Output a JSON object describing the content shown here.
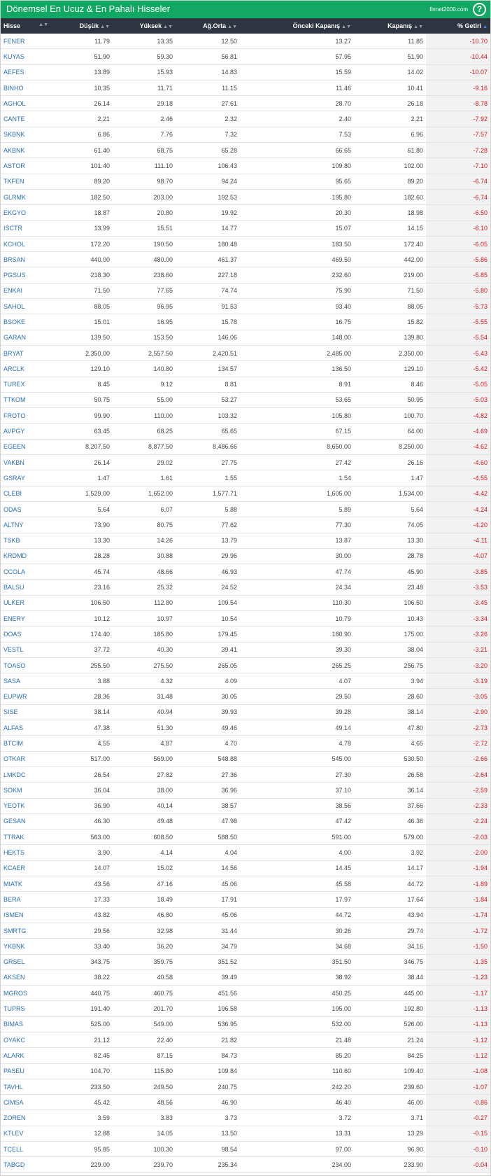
{
  "header": {
    "title": "Dönemsel En Ucuz & En Pahalı Hisseler",
    "brand": "finnet2000.com",
    "help": "?"
  },
  "columns": {
    "hisse": "Hisse",
    "dusuk": "Düşük",
    "yuksek": "Yüksek",
    "agorta": "Ağ.Orta",
    "onceki": "Önceki Kapanış",
    "kapanis": "Kapanış",
    "getiri": "% Getiri"
  },
  "icons": {
    "sort": "sort-arrows-icon",
    "sort_active": "sort-up-icon",
    "help": "help-circle-icon"
  },
  "colors": {
    "header_bg": "#10a862",
    "table_head_bg": "#2f3540",
    "symbol": "#2a6db5",
    "negative": "#d4141c"
  },
  "rows": [
    [
      "FENER",
      "11.79",
      "13.35",
      "12.50",
      "13.27",
      "11.85",
      "-10.70"
    ],
    [
      "KUYAS",
      "51.90",
      "59.30",
      "56.81",
      "57.95",
      "51.90",
      "-10.44"
    ],
    [
      "AEFES",
      "13.89",
      "15.93",
      "14.83",
      "15.59",
      "14.02",
      "-10.07"
    ],
    [
      "BINHO",
      "10.35",
      "11.71",
      "11.15",
      "11.46",
      "10.41",
      "-9.16"
    ],
    [
      "AGHOL",
      "26.14",
      "29.18",
      "27.61",
      "28.70",
      "26.18",
      "-8.78"
    ],
    [
      "CANTE",
      "2.21",
      "2.46",
      "2.32",
      "2.40",
      "2.21",
      "-7.92"
    ],
    [
      "SKBNK",
      "6.86",
      "7.76",
      "7.32",
      "7.53",
      "6.96",
      "-7.57"
    ],
    [
      "AKBNK",
      "61.40",
      "68.75",
      "65.28",
      "66.65",
      "61.80",
      "-7.28"
    ],
    [
      "ASTOR",
      "101.40",
      "111.10",
      "106.43",
      "109.80",
      "102.00",
      "-7.10"
    ],
    [
      "TKFEN",
      "89.20",
      "98.70",
      "94.24",
      "95.65",
      "89.20",
      "-6.74"
    ],
    [
      "GLRMK",
      "182.50",
      "203.00",
      "192.53",
      "195.80",
      "182.60",
      "-6.74"
    ],
    [
      "EKGYO",
      "18.87",
      "20.80",
      "19.92",
      "20.30",
      "18.98",
      "-6.50"
    ],
    [
      "ISCTR",
      "13.99",
      "15.51",
      "14.77",
      "15.07",
      "14.15",
      "-6.10"
    ],
    [
      "KCHOL",
      "172.20",
      "190.50",
      "180.48",
      "183.50",
      "172.40",
      "-6.05"
    ],
    [
      "BRSAN",
      "440.00",
      "480.00",
      "461.37",
      "469.50",
      "442.00",
      "-5.86"
    ],
    [
      "PGSUS",
      "218.30",
      "238.60",
      "227.18",
      "232.60",
      "219.00",
      "-5.85"
    ],
    [
      "ENKAI",
      "71.50",
      "77.65",
      "74.74",
      "75.90",
      "71.50",
      "-5.80"
    ],
    [
      "SAHOL",
      "88.05",
      "96.95",
      "91.53",
      "93.40",
      "88.05",
      "-5.73"
    ],
    [
      "BSOKE",
      "15.01",
      "16.95",
      "15.78",
      "16.75",
      "15.82",
      "-5.55"
    ],
    [
      "GARAN",
      "139.50",
      "153.50",
      "146.06",
      "148.00",
      "139.80",
      "-5.54"
    ],
    [
      "BRYAT",
      "2,350.00",
      "2,557.50",
      "2,420.51",
      "2,485.00",
      "2,350.00",
      "-5.43"
    ],
    [
      "ARCLK",
      "129.10",
      "140.80",
      "134.57",
      "136.50",
      "129.10",
      "-5.42"
    ],
    [
      "TUREX",
      "8.45",
      "9.12",
      "8.81",
      "8.91",
      "8.46",
      "-5.05"
    ],
    [
      "TTKOM",
      "50.75",
      "55.00",
      "53.27",
      "53.65",
      "50.95",
      "-5.03"
    ],
    [
      "FROTO",
      "99.90",
      "110.00",
      "103.32",
      "105.80",
      "100.70",
      "-4.82"
    ],
    [
      "AVPGY",
      "63.45",
      "68.25",
      "65.65",
      "67.15",
      "64.00",
      "-4.69"
    ],
    [
      "EGEEN",
      "8,207.50",
      "8,877.50",
      "8,486.66",
      "8,650.00",
      "8,250.00",
      "-4.62"
    ],
    [
      "VAKBN",
      "26.14",
      "29.02",
      "27.75",
      "27.42",
      "26.16",
      "-4.60"
    ],
    [
      "GSRAY",
      "1.47",
      "1.61",
      "1.55",
      "1.54",
      "1.47",
      "-4.55"
    ],
    [
      "CLEBI",
      "1,529.00",
      "1,652.00",
      "1,577.71",
      "1,605.00",
      "1,534.00",
      "-4.42"
    ],
    [
      "ODAS",
      "5.64",
      "6.07",
      "5.88",
      "5.89",
      "5.64",
      "-4.24"
    ],
    [
      "ALTNY",
      "73.90",
      "80.75",
      "77.62",
      "77.30",
      "74.05",
      "-4.20"
    ],
    [
      "TSKB",
      "13.30",
      "14.26",
      "13.79",
      "13.87",
      "13.30",
      "-4.11"
    ],
    [
      "KRDMD",
      "28.28",
      "30.88",
      "29.96",
      "30.00",
      "28.78",
      "-4.07"
    ],
    [
      "CCOLA",
      "45.74",
      "48.66",
      "46.93",
      "47.74",
      "45.90",
      "-3.85"
    ],
    [
      "BALSU",
      "23.16",
      "25.32",
      "24.52",
      "24.34",
      "23.48",
      "-3.53"
    ],
    [
      "ULKER",
      "106.50",
      "112.80",
      "109.54",
      "110.30",
      "106.50",
      "-3.45"
    ],
    [
      "ENERY",
      "10.12",
      "10.97",
      "10.54",
      "10.79",
      "10.43",
      "-3.34"
    ],
    [
      "DOAS",
      "174.40",
      "185.80",
      "179.45",
      "180.90",
      "175.00",
      "-3.26"
    ],
    [
      "VESTL",
      "37.72",
      "40.30",
      "39.41",
      "39.30",
      "38.04",
      "-3.21"
    ],
    [
      "TOASO",
      "255.50",
      "275.50",
      "265.05",
      "265.25",
      "256.75",
      "-3.20"
    ],
    [
      "SASA",
      "3.88",
      "4.32",
      "4.09",
      "4.07",
      "3.94",
      "-3.19"
    ],
    [
      "EUPWR",
      "28.36",
      "31.48",
      "30.05",
      "29.50",
      "28.60",
      "-3.05"
    ],
    [
      "SISE",
      "38.14",
      "40.94",
      "39.93",
      "39.28",
      "38.14",
      "-2.90"
    ],
    [
      "ALFAS",
      "47.38",
      "51.30",
      "49.46",
      "49.14",
      "47.80",
      "-2.73"
    ],
    [
      "BTCIM",
      "4.55",
      "4.87",
      "4.70",
      "4.78",
      "4.65",
      "-2.72"
    ],
    [
      "OTKAR",
      "517.00",
      "569.00",
      "548.88",
      "545.00",
      "530.50",
      "-2.66"
    ],
    [
      "LMKDC",
      "26.54",
      "27.82",
      "27.36",
      "27.30",
      "26.58",
      "-2.64"
    ],
    [
      "SOKM",
      "36.04",
      "38.00",
      "36.96",
      "37.10",
      "36.14",
      "-2.59"
    ],
    [
      "YEOTK",
      "36.90",
      "40.14",
      "38.57",
      "38.56",
      "37.66",
      "-2.33"
    ],
    [
      "GESAN",
      "46.30",
      "49.48",
      "47.98",
      "47.42",
      "46.36",
      "-2.24"
    ],
    [
      "TTRAK",
      "563.00",
      "608.50",
      "588.50",
      "591.00",
      "579.00",
      "-2.03"
    ],
    [
      "HEKTS",
      "3.90",
      "4.14",
      "4.04",
      "4.00",
      "3.92",
      "-2.00"
    ],
    [
      "KCAER",
      "14.07",
      "15.02",
      "14.56",
      "14.45",
      "14.17",
      "-1.94"
    ],
    [
      "MIATK",
      "43.56",
      "47.16",
      "45.06",
      "45.58",
      "44.72",
      "-1.89"
    ],
    [
      "BERA",
      "17.33",
      "18.49",
      "17.91",
      "17.97",
      "17.64",
      "-1.84"
    ],
    [
      "ISMEN",
      "43.82",
      "46.80",
      "45.06",
      "44.72",
      "43.94",
      "-1.74"
    ],
    [
      "SMRTG",
      "29.56",
      "32.98",
      "31.44",
      "30.26",
      "29.74",
      "-1.72"
    ],
    [
      "YKBNK",
      "33.40",
      "36.20",
      "34.79",
      "34.68",
      "34.16",
      "-1.50"
    ],
    [
      "GRSEL",
      "343.75",
      "359.75",
      "351.52",
      "351.50",
      "346.75",
      "-1.35"
    ],
    [
      "AKSEN",
      "38.22",
      "40.58",
      "39.49",
      "38.92",
      "38.44",
      "-1.23"
    ],
    [
      "MGROS",
      "440.75",
      "460.75",
      "451.56",
      "450.25",
      "445.00",
      "-1.17"
    ],
    [
      "TUPRS",
      "191.40",
      "201.70",
      "196.58",
      "195.00",
      "192.80",
      "-1.13"
    ],
    [
      "BIMAS",
      "525.00",
      "549.00",
      "536.95",
      "532.00",
      "526.00",
      "-1.13"
    ],
    [
      "OYAKC",
      "21.12",
      "22.40",
      "21.82",
      "21.48",
      "21.24",
      "-1.12"
    ],
    [
      "ALARK",
      "82.45",
      "87.15",
      "84.73",
      "85.20",
      "84.25",
      "-1.12"
    ],
    [
      "PASEU",
      "104.70",
      "115.80",
      "109.84",
      "110.60",
      "109.40",
      "-1.08"
    ],
    [
      "TAVHL",
      "233.50",
      "249.50",
      "240.75",
      "242.20",
      "239.60",
      "-1.07"
    ],
    [
      "CIMSA",
      "45.42",
      "48.56",
      "46.90",
      "46.40",
      "46.00",
      "-0.86"
    ],
    [
      "ZOREN",
      "3.59",
      "3.83",
      "3.73",
      "3.72",
      "3.71",
      "-0.27"
    ],
    [
      "KTLEV",
      "12.88",
      "14.05",
      "13.50",
      "13.31",
      "13.29",
      "-0.15"
    ],
    [
      "TCELL",
      "95.85",
      "100.30",
      "98.54",
      "97.00",
      "96.90",
      "-0.10"
    ],
    [
      "TABGD",
      "229.00",
      "239.70",
      "235.34",
      "234.00",
      "233.90",
      "-0.04"
    ]
  ]
}
